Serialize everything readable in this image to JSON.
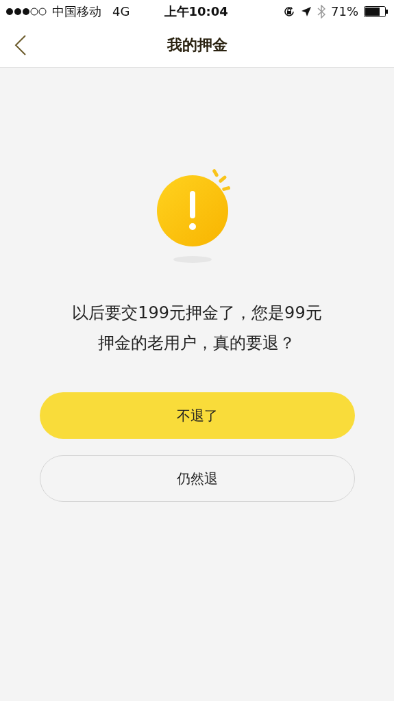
{
  "status_bar": {
    "carrier": "中国移动",
    "network": "4G",
    "time": "上午10:04",
    "battery_text": "71%"
  },
  "nav": {
    "title": "我的押金"
  },
  "message": {
    "lines": [
      "以后要交199元押金了，您是99元",
      "押金的老用户，真的要退？"
    ]
  },
  "buttons": [
    {
      "label": "不退了",
      "kind": "primary"
    },
    {
      "label": "仍然退",
      "kind": "outline"
    }
  ]
}
